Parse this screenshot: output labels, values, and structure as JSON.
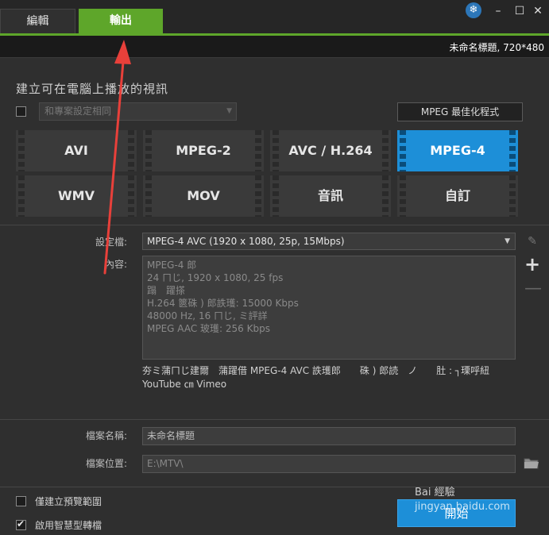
{
  "tabs": {
    "edit": "編輯",
    "output": "輸出"
  },
  "window_controls": {
    "settings_icon": "❄",
    "minimize": "–",
    "maximize": "☐",
    "close": "✕"
  },
  "project": {
    "info": "未命名標題, 720*480"
  },
  "section_title": "建立可在電腦上播放的視訊",
  "same_project": {
    "checked": false,
    "placeholder": "和專案設定相同"
  },
  "mpeg_optimizer_label": "MPEG 最佳化程式",
  "formats": [
    {
      "label": "AVI",
      "selected": false
    },
    {
      "label": "MPEG-2",
      "selected": false
    },
    {
      "label": "AVC / H.264",
      "selected": false
    },
    {
      "label": "MPEG-4",
      "selected": true
    },
    {
      "label": "WMV",
      "selected": false
    },
    {
      "label": "MOV",
      "selected": false
    },
    {
      "label": "音訊",
      "selected": false
    },
    {
      "label": "自訂",
      "selected": false
    }
  ],
  "profile": {
    "label": "設定檔:",
    "value": "MPEG-4 AVC (1920 x 1080, 25p, 15Mbps)"
  },
  "content": {
    "label": "內容:",
    "lines": [
      "MPEG-4 郎",
      "24 ㄇじ, 1920 x 1080, 25 fps",
      "蹋　躍搽",
      "H.264 篋硃 ) 郎詄瓁: 15000 Kbps",
      "48000 Hz, 16 ㄇじ, ミ評詳",
      "MPEG AAC 玻瓁: 256 Kbps"
    ]
  },
  "description": [
    "夯ミ蒲ㄇじ建爾　蒲躍借 MPEG-4 AVC 詄瓁郎　　硃 ) 郎読　ノ　　肚 : ┐瑮呼紐",
    "YouTube ㎝ Vimeo"
  ],
  "side_icons": {
    "edit": "✎",
    "add": "+",
    "remove": "—"
  },
  "file_name": {
    "label": "檔案名稱:",
    "value": "未命名標題"
  },
  "file_location": {
    "label": "檔案位置:",
    "value": "E:\\MTV\\"
  },
  "options": {
    "preview_only": {
      "label": "僅建立預覽範圍",
      "checked": false
    },
    "smart_render": {
      "label": "啟用智慧型轉檔",
      "checked": true
    }
  },
  "start_button": "開始",
  "watermark": {
    "line1": "Bai 經驗",
    "line2": "jingyan.baidu.com"
  },
  "colors": {
    "accent_green": "#5ea62a",
    "accent_blue": "#1d8fd8",
    "arrow_red": "#e8403a"
  }
}
